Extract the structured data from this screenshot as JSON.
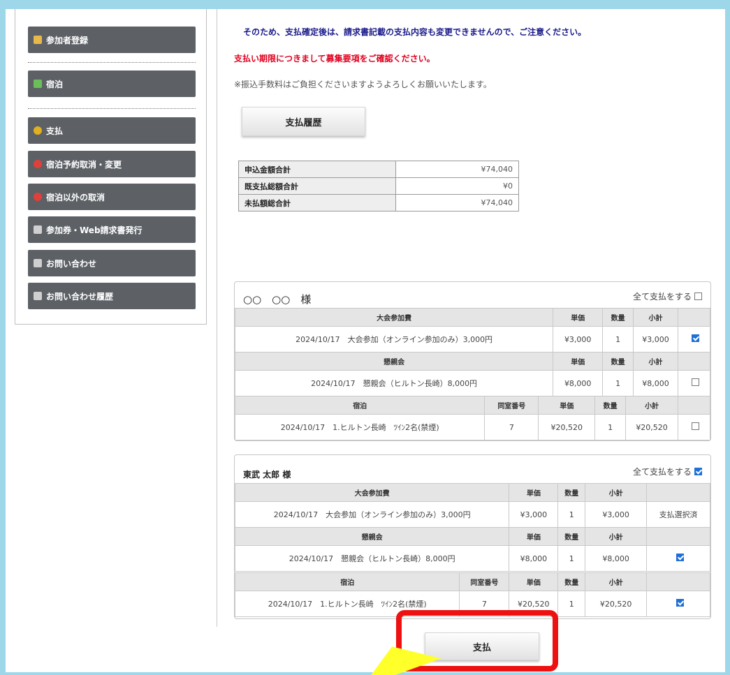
{
  "sidebar": {
    "items": [
      {
        "label": "参加者登録",
        "icon": "person-icon",
        "color": "#e8b84a"
      },
      {
        "label": "宿泊",
        "icon": "hotel-icon",
        "color": "#6bbf59"
      },
      {
        "label": "支払",
        "icon": "yen-icon",
        "color": "#e0b020"
      },
      {
        "label": "宿泊予約取消・変更",
        "icon": "cancel-icon",
        "color": "#e0403a"
      },
      {
        "label": "宿泊以外の取消",
        "icon": "cancel-icon",
        "color": "#e0403a"
      },
      {
        "label": "参加券・Web請求書発行",
        "icon": "ticket-icon",
        "color": "#cfcfcf"
      },
      {
        "label": "お問い合わせ",
        "icon": "mail-icon",
        "color": "#cfcfcf"
      },
      {
        "label": "お問い合わせ履歴",
        "icon": "history-icon",
        "color": "#cfcfcf"
      }
    ]
  },
  "notices": {
    "line1": "そのため、支払確定後は、請求書記載の支払内容も変更できませんので、ご注意ください。",
    "line2": "支払い期限につきまして募集要項をご確認ください。",
    "line3": "※振込手数料はご負担くださいますようよろしくお願いいたします。"
  },
  "history_button": "支払履歴",
  "summary": [
    {
      "label": "申込金額合計",
      "value": "¥74,040"
    },
    {
      "label": "既支払総額合計",
      "value": "¥0"
    },
    {
      "label": "未払額総合計",
      "value": "¥74,040"
    }
  ],
  "headers": {
    "price": "単価",
    "qty": "数量",
    "subtotal": "小計",
    "room": "同室番号"
  },
  "persons": [
    {
      "name": "○○　○○　様",
      "pay_all_label": "全て支払をする",
      "pay_all_checked": false,
      "sections": [
        {
          "title": "大会参加費",
          "item": "2024/10/17　大会参加（オンライン参加のみ）3,000円",
          "price": "¥3,000",
          "qty": "1",
          "subtotal": "¥3,000",
          "checked": true
        },
        {
          "title": "懇親会",
          "item": "2024/10/17　懇親会（ヒルトン長崎）8,000円",
          "price": "¥8,000",
          "qty": "1",
          "subtotal": "¥8,000",
          "checked": false
        },
        {
          "title": "宿泊",
          "item": "2024/10/17　1.ヒルトン長崎　ﾂｲﾝ2名(禁煙)",
          "room": "7",
          "price": "¥20,520",
          "qty": "1",
          "subtotal": "¥20,520",
          "checked": false
        }
      ]
    },
    {
      "name": "東武 太郎 様",
      "pay_all_label": "全て支払をする",
      "pay_all_checked": true,
      "sections": [
        {
          "title": "大会参加費",
          "item": "2024/10/17　大会参加（オンライン参加のみ）3,000円",
          "price": "¥3,000",
          "qty": "1",
          "subtotal": "¥3,000",
          "status": "支払選択済"
        },
        {
          "title": "懇親会",
          "item": "2024/10/17　懇親会（ヒルトン長崎）8,000円",
          "price": "¥8,000",
          "qty": "1",
          "subtotal": "¥8,000",
          "checked": true
        },
        {
          "title": "宿泊",
          "item": "2024/10/17　1.ヒルトン長崎　ﾂｲﾝ2名(禁煙)",
          "room": "7",
          "price": "¥20,520",
          "qty": "1",
          "subtotal": "¥20,520",
          "checked": true
        }
      ]
    }
  ],
  "pay_button": "支払",
  "colors": {
    "highlight": "#ee1111",
    "arrow": "#ffff2a",
    "checkbox": "#1f6fd6"
  }
}
